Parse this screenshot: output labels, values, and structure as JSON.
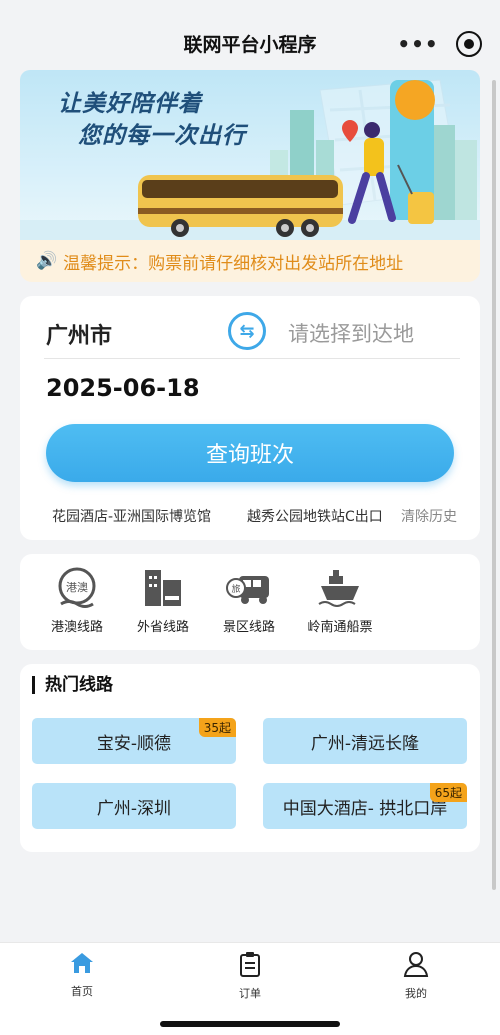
{
  "header": {
    "title": "联网平台小程序",
    "more_icon": "more-dots-icon",
    "close_icon": "target-circle-icon"
  },
  "banner": {
    "line1": "让美好陪伴着",
    "line2": "您的每一次出行"
  },
  "notice": {
    "icon": "speaker-icon",
    "text": "温馨提示：购票前请仔细核对出发站所在地址"
  },
  "search": {
    "from": "广州市",
    "to_placeholder": "请选择到达地",
    "date": "2025-06-18",
    "query_label": "查询班次",
    "history": [
      "花园酒店-亚洲国际博览馆",
      "越秀公园地铁站C出口"
    ],
    "clear_label": "清除历史"
  },
  "categories": [
    {
      "label": "港澳线路",
      "icon": "hk-macau-icon"
    },
    {
      "label": "外省线路",
      "icon": "buildings-icon"
    },
    {
      "label": "景区线路",
      "icon": "tour-bus-icon"
    },
    {
      "label": "岭南通船票",
      "icon": "ship-icon"
    }
  ],
  "hot_routes": {
    "title": "热门线路",
    "items": [
      {
        "label": "宝安-顺德",
        "tag": "35起"
      },
      {
        "label": "广州-清远长隆",
        "tag": ""
      },
      {
        "label": "广州-深圳",
        "tag": ""
      },
      {
        "label": "中国大酒店- 拱北口岸",
        "tag": "65起"
      }
    ]
  },
  "tabbar": {
    "items": [
      {
        "label": "首页",
        "icon": "home-icon",
        "active": true
      },
      {
        "label": "订单",
        "icon": "clipboard-icon",
        "active": false
      },
      {
        "label": "我的",
        "icon": "user-icon",
        "active": false
      }
    ]
  },
  "colors": {
    "accent": "#3aaaea",
    "notice_text": "#e08c1a",
    "route_bg": "#b9e3f9",
    "tag_bg": "#f4a31a"
  }
}
